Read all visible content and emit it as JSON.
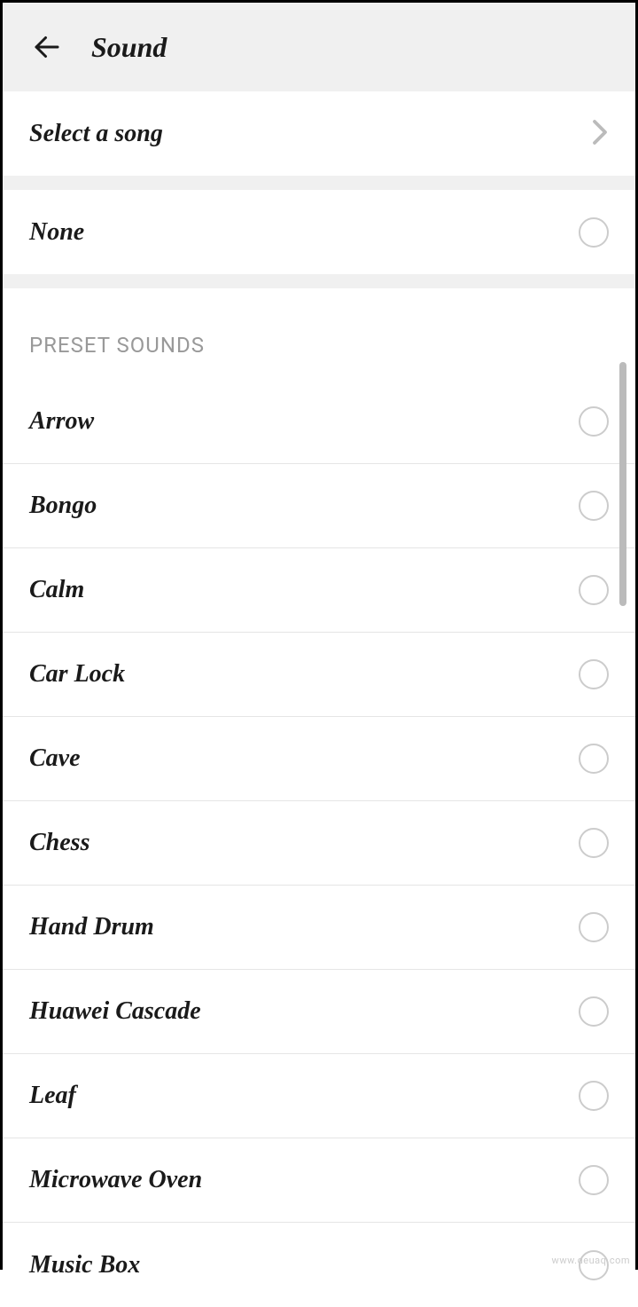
{
  "header": {
    "title": "Sound"
  },
  "select_song": {
    "label": "Select a song"
  },
  "none": {
    "label": "None"
  },
  "preset_section": {
    "header": "PRESET SOUNDS",
    "items": [
      {
        "label": "Arrow"
      },
      {
        "label": "Bongo"
      },
      {
        "label": "Calm"
      },
      {
        "label": "Car Lock"
      },
      {
        "label": "Cave"
      },
      {
        "label": "Chess"
      },
      {
        "label": "Hand Drum"
      },
      {
        "label": "Huawei Cascade"
      },
      {
        "label": "Leaf"
      },
      {
        "label": "Microwave Oven"
      },
      {
        "label": "Music Box"
      }
    ]
  },
  "watermark": "www.deuaq.com"
}
